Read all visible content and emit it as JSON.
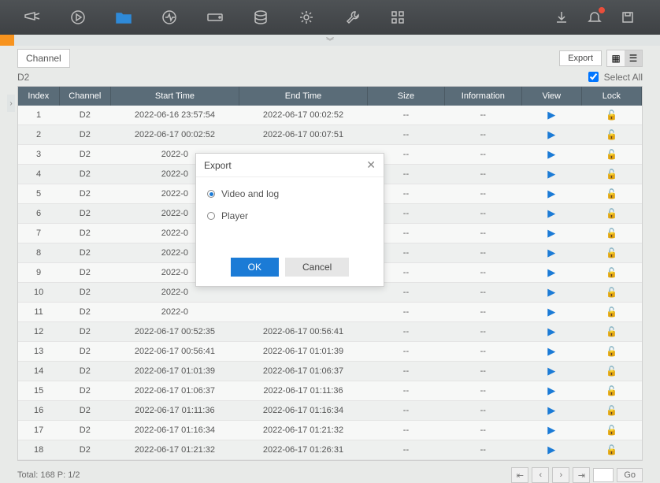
{
  "topbar": {
    "icons": [
      "camera-icon",
      "playback-icon",
      "folder-icon",
      "status-icon",
      "hdd-icon",
      "storage-icon",
      "settings-icon",
      "maintenance-icon",
      "apps-icon"
    ],
    "right_icons": [
      "download-icon",
      "alarm-icon",
      "save-icon"
    ]
  },
  "tabs": {
    "channel": "Channel"
  },
  "toolbar": {
    "export_btn": "Export",
    "select_all": "Select All",
    "device_label": "D2"
  },
  "table": {
    "headers": [
      "Index",
      "Channel",
      "Start Time",
      "End Time",
      "Size",
      "Information",
      "View",
      "Lock"
    ],
    "rows": [
      {
        "idx": "1",
        "ch": "D2",
        "start": "2022-06-16 23:57:54",
        "end": "2022-06-17 00:02:52",
        "size": "--",
        "info": "--"
      },
      {
        "idx": "2",
        "ch": "D2",
        "start": "2022-06-17 00:02:52",
        "end": "2022-06-17 00:07:51",
        "size": "--",
        "info": "--"
      },
      {
        "idx": "3",
        "ch": "D2",
        "start": "2022-0",
        "end": "",
        "size": "--",
        "info": "--"
      },
      {
        "idx": "4",
        "ch": "D2",
        "start": "2022-0",
        "end": "",
        "size": "--",
        "info": "--"
      },
      {
        "idx": "5",
        "ch": "D2",
        "start": "2022-0",
        "end": "",
        "size": "--",
        "info": "--"
      },
      {
        "idx": "6",
        "ch": "D2",
        "start": "2022-0",
        "end": "",
        "size": "--",
        "info": "--"
      },
      {
        "idx": "7",
        "ch": "D2",
        "start": "2022-0",
        "end": "",
        "size": "--",
        "info": "--"
      },
      {
        "idx": "8",
        "ch": "D2",
        "start": "2022-0",
        "end": "",
        "size": "--",
        "info": "--"
      },
      {
        "idx": "9",
        "ch": "D2",
        "start": "2022-0",
        "end": "",
        "size": "--",
        "info": "--"
      },
      {
        "idx": "10",
        "ch": "D2",
        "start": "2022-0",
        "end": "",
        "size": "--",
        "info": "--"
      },
      {
        "idx": "11",
        "ch": "D2",
        "start": "2022-0",
        "end": "",
        "size": "--",
        "info": "--"
      },
      {
        "idx": "12",
        "ch": "D2",
        "start": "2022-06-17 00:52:35",
        "end": "2022-06-17 00:56:41",
        "size": "--",
        "info": "--"
      },
      {
        "idx": "13",
        "ch": "D2",
        "start": "2022-06-17 00:56:41",
        "end": "2022-06-17 01:01:39",
        "size": "--",
        "info": "--"
      },
      {
        "idx": "14",
        "ch": "D2",
        "start": "2022-06-17 01:01:39",
        "end": "2022-06-17 01:06:37",
        "size": "--",
        "info": "--"
      },
      {
        "idx": "15",
        "ch": "D2",
        "start": "2022-06-17 01:06:37",
        "end": "2022-06-17 01:11:36",
        "size": "--",
        "info": "--"
      },
      {
        "idx": "16",
        "ch": "D2",
        "start": "2022-06-17 01:11:36",
        "end": "2022-06-17 01:16:34",
        "size": "--",
        "info": "--"
      },
      {
        "idx": "17",
        "ch": "D2",
        "start": "2022-06-17 01:16:34",
        "end": "2022-06-17 01:21:32",
        "size": "--",
        "info": "--"
      },
      {
        "idx": "18",
        "ch": "D2",
        "start": "2022-06-17 01:21:32",
        "end": "2022-06-17 01:26:31",
        "size": "--",
        "info": "--"
      }
    ]
  },
  "footer": {
    "total": "Total: 168  P: 1/2",
    "page_input": "",
    "go": "Go"
  },
  "dialog": {
    "title": "Export",
    "opt1": "Video and log",
    "opt2": "Player",
    "ok": "OK",
    "cancel": "Cancel"
  }
}
